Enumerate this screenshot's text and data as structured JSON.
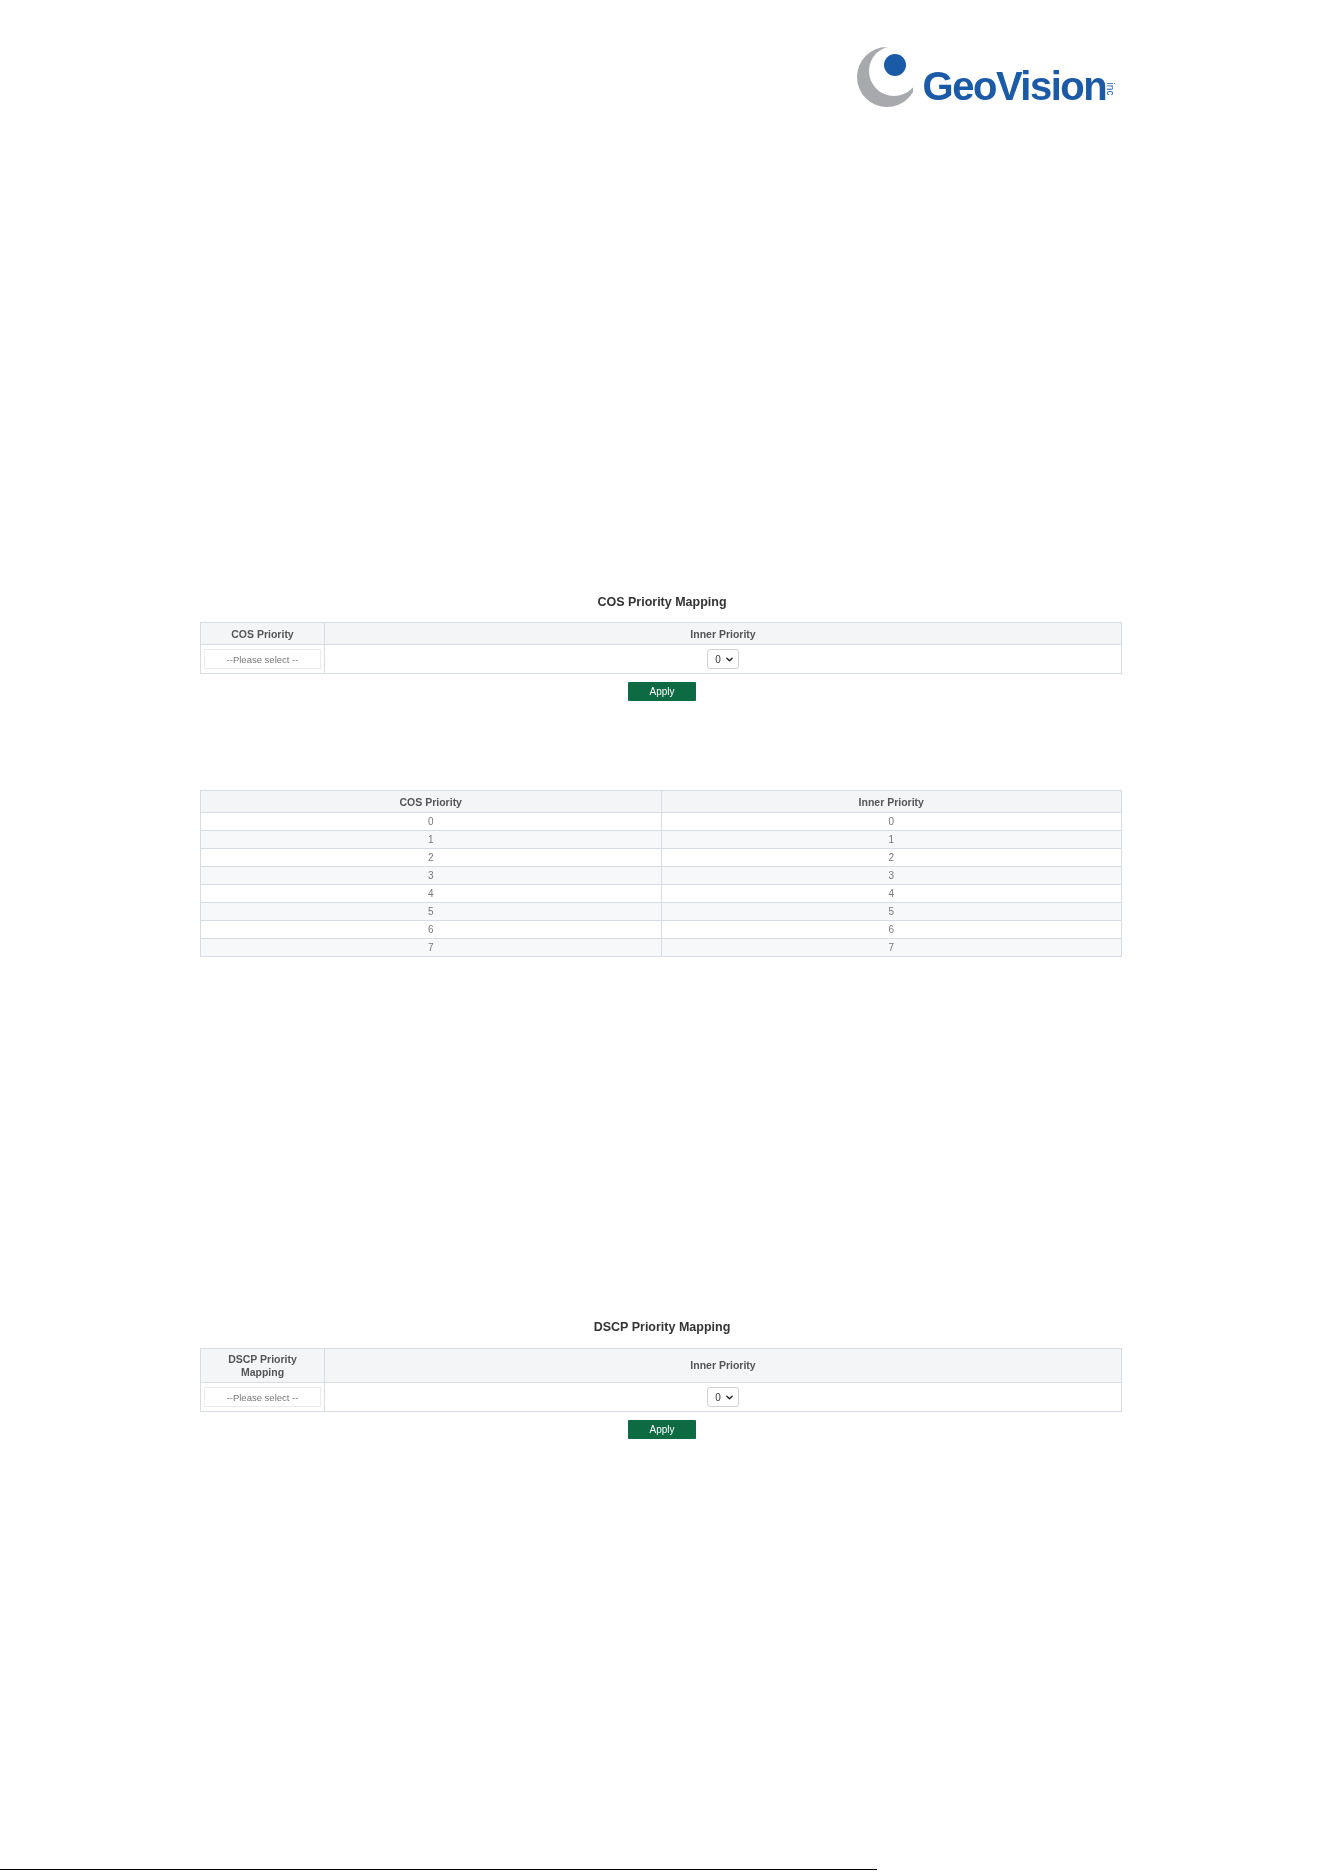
{
  "logo": {
    "name": "GeoVision",
    "suffix": "inc"
  },
  "cos_form": {
    "title": "COS Priority Mapping",
    "columns": [
      "COS Priority",
      "Inner Priority"
    ],
    "mapping_select": {
      "placeholder": "--Please select --"
    },
    "inner_priority_select": {
      "value": "0"
    },
    "button": "Apply"
  },
  "cos_table": {
    "columns": [
      "COS Priority",
      "Inner Priority"
    ],
    "rows": [
      [
        "0",
        "0"
      ],
      [
        "1",
        "1"
      ],
      [
        "2",
        "2"
      ],
      [
        "3",
        "3"
      ],
      [
        "4",
        "4"
      ],
      [
        "5",
        "5"
      ],
      [
        "6",
        "6"
      ],
      [
        "7",
        "7"
      ]
    ]
  },
  "dscp_form": {
    "title": "DSCP Priority Mapping",
    "columns": [
      "DSCP Priority Mapping",
      "Inner Priority"
    ],
    "mapping_select": {
      "placeholder": "--Please select --"
    },
    "inner_priority_select": {
      "value": "0"
    },
    "button": "Apply"
  }
}
